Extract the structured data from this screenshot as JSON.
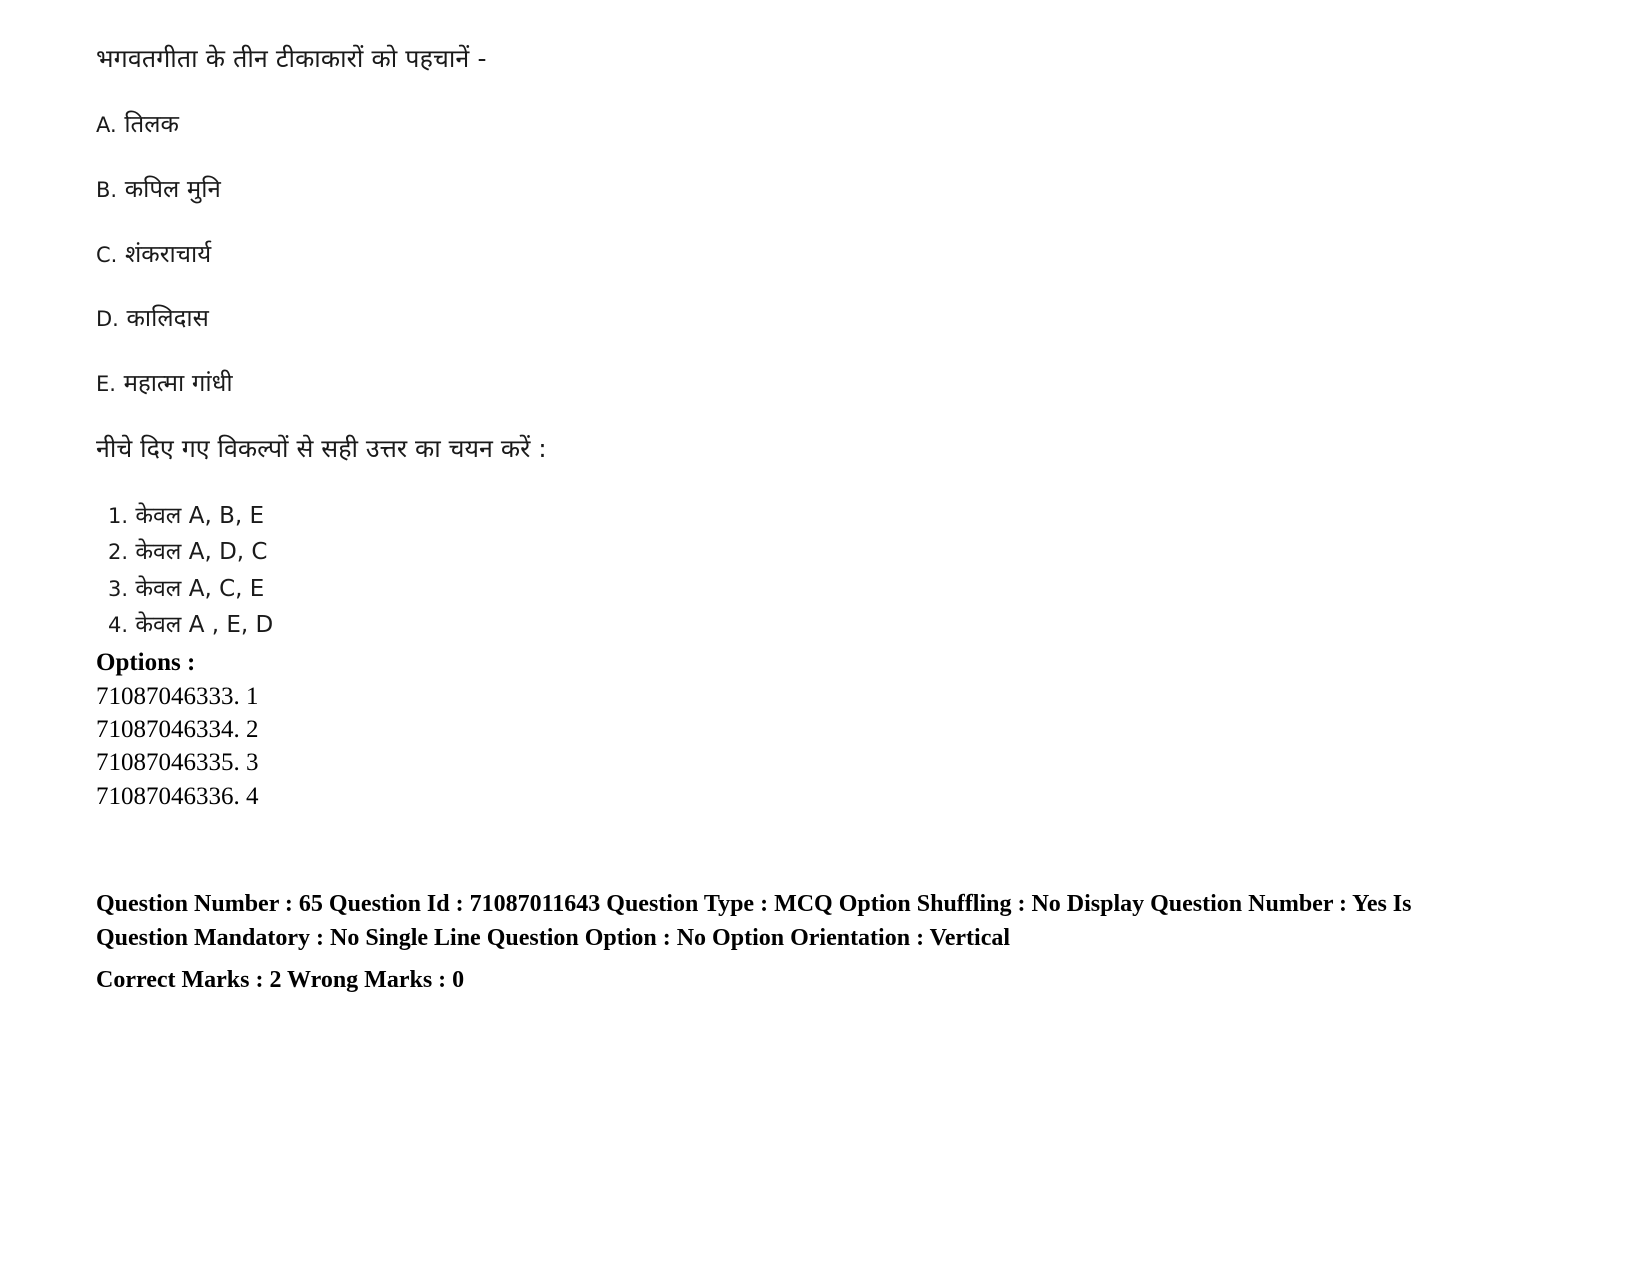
{
  "question": {
    "stem": "भगवतगीता के तीन टीकाकारों को पहचानें  -",
    "items": [
      {
        "key": "A.",
        "text": "तिलक"
      },
      {
        "key": "B.",
        "text": "कपिल मुनि"
      },
      {
        "key": "C.",
        "text": "शंकराचार्य"
      },
      {
        "key": "D.",
        "text": "कालिदास"
      },
      {
        "key": "E.",
        "text": "महात्मा गांधी"
      }
    ],
    "directive": "नीचे दिए गए विकल्पों से सही उत्तर का चयन करें :",
    "choices": [
      {
        "num": "1.",
        "text": "केवल A, B, E"
      },
      {
        "num": "2.",
        "text": "केवल A, D, C"
      },
      {
        "num": "3.",
        "text": "केवल A, C, E"
      },
      {
        "num": "4.",
        "text": "केवल A , E, D"
      }
    ]
  },
  "options": {
    "heading": "Options :",
    "entries": [
      {
        "id": "71087046333.",
        "value": "1"
      },
      {
        "id": "71087046334.",
        "value": "2"
      },
      {
        "id": "71087046335.",
        "value": "3"
      },
      {
        "id": "71087046336.",
        "value": "4"
      }
    ]
  },
  "metadata": {
    "details": "Question Number : 65 Question Id : 71087011643 Question Type : MCQ Option Shuffling : No Display Question Number : Yes Is Question Mandatory : No Single Line Question Option : No Option Orientation : Vertical",
    "marks": "Correct Marks : 2 Wrong Marks : 0"
  }
}
